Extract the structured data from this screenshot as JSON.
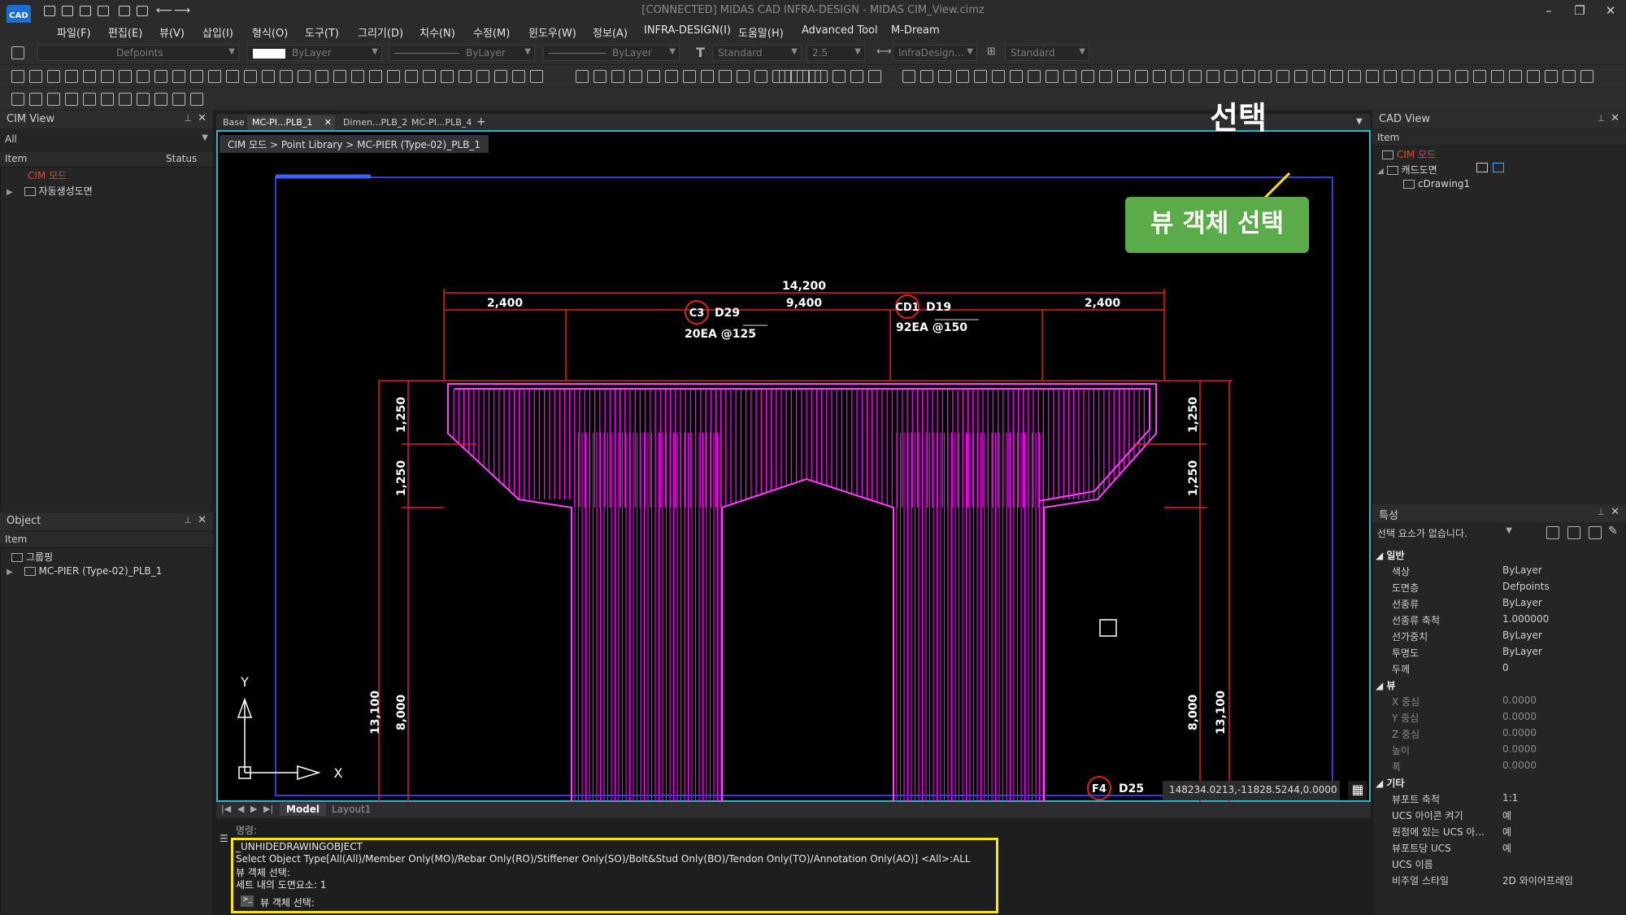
{
  "window": {
    "title": "[CONNECTED] MIDAS CAD INFRA-DESIGN - MIDAS CIM_View.cimz",
    "logo": "CAD",
    "minimize": "–",
    "restore": "❐",
    "close": "✕"
  },
  "menu": [
    "파일(F)",
    "편집(E)",
    "뷰(V)",
    "삽입(I)",
    "형식(O)",
    "도구(T)",
    "그리기(D)",
    "치수(N)",
    "수정(M)",
    "윈도우(W)",
    "정보(A)",
    "INFRA-DESIGN(I)",
    "도움말(H)",
    "Advanced Tool",
    "M-Dream"
  ],
  "toolbar": {
    "layer_combo": "Defpoints",
    "color_combo": "ByLayer",
    "linetype_combo": "ByLayer",
    "lineweight_combo": "ByLayer",
    "text_style_combo": "Standard",
    "text_height_combo": "2.5",
    "dim_style_combo": "InfraDesign...",
    "table_style_combo": "Standard"
  },
  "cim_view_panel": {
    "title": "CIM View",
    "filter": "All",
    "col_item": "Item",
    "col_status": "Status",
    "root": "CIM 모드",
    "child": "자동생성도면"
  },
  "object_panel": {
    "title": "Object",
    "col_item": "Item",
    "group": "그룹핑",
    "child": "MC-PIER (Type-02)_PLB_1"
  },
  "doc_tabs": [
    "Base",
    "MC-PI...PLB_1",
    "Dimen...PLB_2",
    "MC-PI...PLB_4"
  ],
  "tab_close": "✕",
  "tab_add": "+",
  "breadcrumb": "CIM 모드 > Point Library > MC-PIER (Type-02)_PLB_1",
  "drawing": {
    "dim_top_total": "14,200",
    "dim_left": "2,400",
    "dim_mid": "9,400",
    "dim_right": "2,400",
    "tag_c3": "C3",
    "tag_c3_rebar": "D29",
    "tag_c3_spacing": "20EA @125",
    "tag_cd1": "CD1",
    "tag_cd1_rebar": "D19",
    "tag_cd1_spacing": "92EA @150",
    "dim_v1_left": "1,250",
    "dim_v2_left": "1,250",
    "dim_v1_right": "1,250",
    "dim_v2_right": "1,250",
    "dim_h_left_outer": "13,100",
    "dim_h_left_inner": "8,000",
    "dim_h_right_inner": "8,000",
    "dim_h_right_outer": "13,100",
    "tag_f4": "F4",
    "tag_f4_rebar": "D25",
    "axis_y": "Y",
    "axis_x": "X"
  },
  "coord_readout": "148234.0213,-11828.5244,0.0000",
  "annotation": {
    "select_text": "선택",
    "badge": "뷰 객체 선택"
  },
  "layout_tabs": [
    "Model",
    "Layout1"
  ],
  "command": {
    "prev_line": "명령:",
    "lines": [
      "_UNHIDEDRAWINGOBJECT",
      "Select Object Type[All(All)/Member Only(MO)/Rebar Only(RO)/Stiffener Only(SO)/Bolt&Stud Only(BO)/Tendon Only(TO)/Annotation Only(AO)] <All>:ALL",
      "뷰 객체 선택:",
      "세트 내의 도면요소: 1"
    ],
    "prompt": "뷰 객체 선택:"
  },
  "cad_view_panel": {
    "title": "CAD View",
    "col_item": "Item",
    "root": "CIM 모드",
    "child": "캐드도면",
    "leaf": "cDrawing1"
  },
  "properties_panel": {
    "title": "특성",
    "selection": "선택 요소가 없습니다.",
    "groups": {
      "general": "일반",
      "view": "뷰",
      "misc": "기타"
    },
    "general": [
      {
        "k": "색상",
        "v": "ByLayer"
      },
      {
        "k": "도면층",
        "v": "Defpoints"
      },
      {
        "k": "선종류",
        "v": "ByLayer"
      },
      {
        "k": "선종류 축척",
        "v": "1.000000"
      },
      {
        "k": "선가중치",
        "v": "ByLayer"
      },
      {
        "k": "투명도",
        "v": "ByLayer"
      },
      {
        "k": "두께",
        "v": "0"
      }
    ],
    "view": [
      {
        "k": "X 중심",
        "v": "0.0000"
      },
      {
        "k": "Y 중심",
        "v": "0.0000"
      },
      {
        "k": "Z 중심",
        "v": "0.0000"
      },
      {
        "k": "높이",
        "v": "0.0000"
      },
      {
        "k": "폭",
        "v": "0.0000"
      }
    ],
    "misc": [
      {
        "k": "뷰포트 축척",
        "v": "1:1"
      },
      {
        "k": "UCS 아이콘 켜기",
        "v": "예"
      },
      {
        "k": "원점에 있는 UCS 아...",
        "v": "예"
      },
      {
        "k": "뷰포트당 UCS",
        "v": "예"
      },
      {
        "k": "UCS 이름",
        "v": ""
      },
      {
        "k": "비주얼 스타일",
        "v": "2D 와이어프레임"
      }
    ]
  },
  "colors": {
    "accent_cyan": "#29b6c9",
    "rebar_magenta": "#ff00ff",
    "dim_red": "#e02020",
    "highlight_yellow": "#ffe21a",
    "badge_green": "#5cab4a",
    "cim_red": "#e8462b"
  }
}
